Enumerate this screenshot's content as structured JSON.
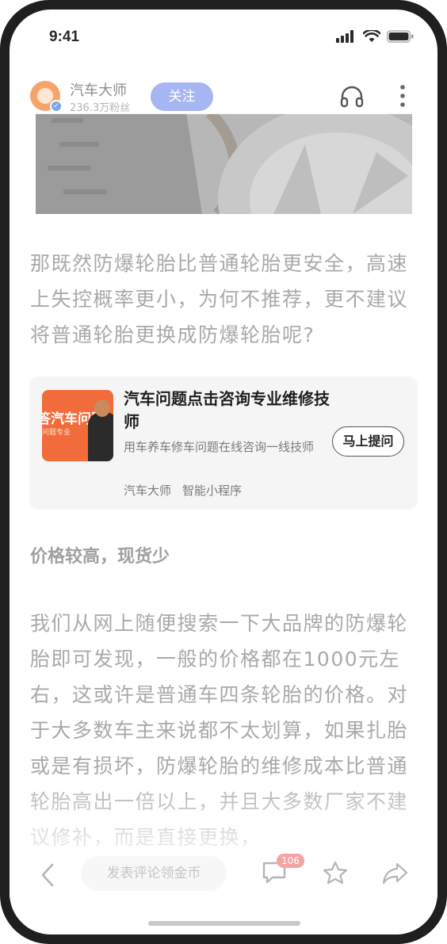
{
  "status_bar": {
    "time": "9:41"
  },
  "header": {
    "author_name": "汽车大师",
    "author_fans": "236.3万粉丝",
    "follow_label": "关注",
    "icons": [
      "headphone-icon",
      "more-vertical-icon"
    ]
  },
  "article": {
    "paragraph_1": "那既然防爆轮胎比普通轮胎更安全，高速上失控概率更小，为何不推荐，更不建议将普通轮胎更换成防爆轮胎呢?",
    "section_heading": "价格较高，现货少",
    "paragraph_2": "我们从网上随便搜索一下大品牌的防爆轮胎即可发现，一般的价格都在1000元左右，这或许是普通车四条轮胎的价格。对于大多数车主来说都不太划算，如果扎胎或是有损坏，防爆轮胎的维修成本比普通轮胎高出一倍以上，并且大多数厂家不建议修补，而是直接更换，"
  },
  "promo_card": {
    "thumb_text": "答汽车问题",
    "thumb_sub": "问题专业",
    "title": "汽车问题点击咨询专业维修技师",
    "description": "用车养车修车问题在线咨询一线技师",
    "meta_source": "汽车大师",
    "meta_type": "智能小程序",
    "ask_label": "马上提问"
  },
  "toolbar": {
    "comment_placeholder": "发表评论领金币",
    "comment_count": "106",
    "icons": [
      "back-icon",
      "comment-icon",
      "star-icon",
      "share-icon"
    ]
  }
}
